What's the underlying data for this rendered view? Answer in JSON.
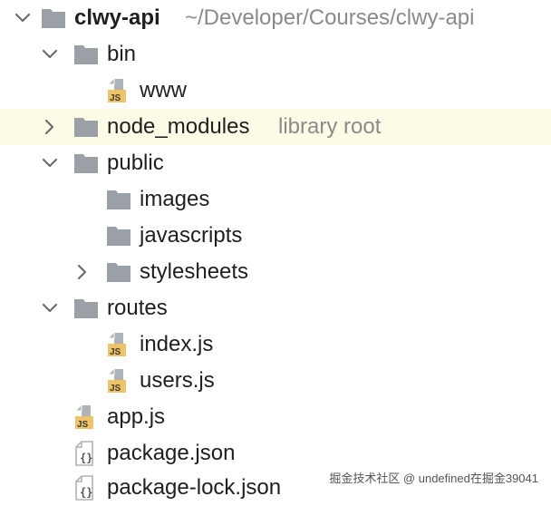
{
  "colors": {
    "folder": "#9aa0a6",
    "file_page": "#aeb3b8",
    "js_badge": "#f0c36a",
    "chevron": "#6d6d6d",
    "highlight_row": "#fbfbe6",
    "hint_text": "#8a8a8a"
  },
  "tree": {
    "root": {
      "name": "clwy-api",
      "path_hint": "~/Developer/Courses/clwy-api",
      "expanded": true,
      "icon": "folder-icon"
    },
    "items": [
      {
        "name": "bin",
        "type": "folder",
        "expanded": true,
        "icon": "folder-icon"
      },
      {
        "name": "www",
        "type": "js-file",
        "icon": "js-file-icon",
        "badge": "JS"
      },
      {
        "name": "node_modules",
        "type": "folder",
        "expanded": false,
        "hint": "library root",
        "icon": "folder-icon",
        "highlighted": true
      },
      {
        "name": "public",
        "type": "folder",
        "expanded": true,
        "icon": "folder-icon"
      },
      {
        "name": "images",
        "type": "folder",
        "icon": "folder-icon"
      },
      {
        "name": "javascripts",
        "type": "folder",
        "icon": "folder-icon"
      },
      {
        "name": "stylesheets",
        "type": "folder",
        "expanded": false,
        "icon": "folder-icon"
      },
      {
        "name": "routes",
        "type": "folder",
        "expanded": true,
        "icon": "folder-icon"
      },
      {
        "name": "index.js",
        "type": "js-file",
        "icon": "js-file-icon",
        "badge": "JS"
      },
      {
        "name": "users.js",
        "type": "js-file",
        "icon": "js-file-icon",
        "badge": "JS"
      },
      {
        "name": "app.js",
        "type": "js-file",
        "icon": "js-file-icon",
        "badge": "JS"
      },
      {
        "name": "package.json",
        "type": "json-file",
        "icon": "json-file-icon"
      },
      {
        "name": "package-lock.json",
        "type": "json-file",
        "icon": "json-file-icon"
      }
    ]
  },
  "watermark": "掘金技术社区 @ undefined在掘金39041"
}
